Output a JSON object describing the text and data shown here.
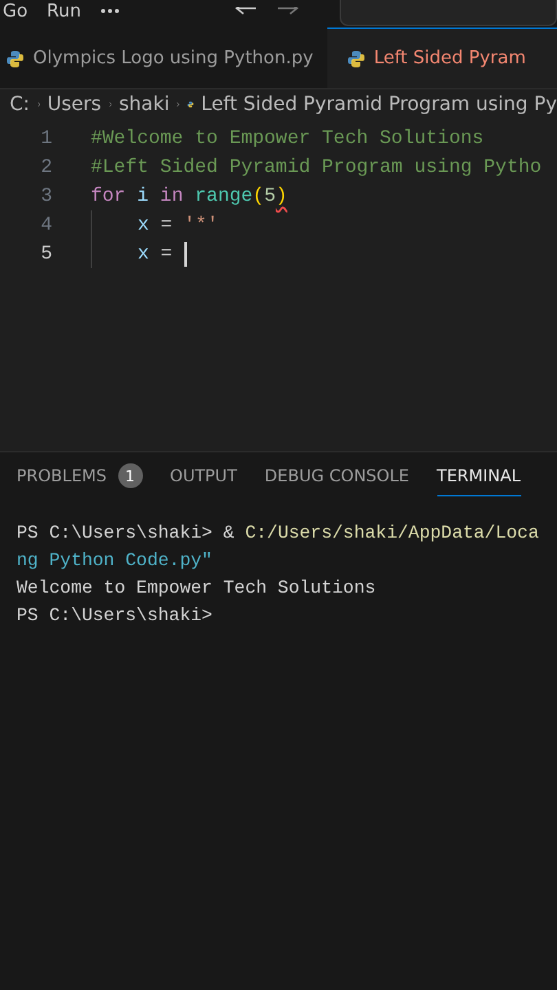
{
  "menu": [
    "Go",
    "Run"
  ],
  "tabs": [
    {
      "label": "Olympics Logo using Python.py",
      "selected": false,
      "error": false
    },
    {
      "label": "Left Sided Pyram",
      "selected": true,
      "error": true
    }
  ],
  "breadcrumb": [
    "C:",
    "Users",
    "shaki",
    "Left Sided Pyramid Program using Py"
  ],
  "code": [
    {
      "number": "1",
      "current": false,
      "tokens": [
        {
          "kind": "comment",
          "text": "#Welcome to Empower Tech Solutions"
        }
      ]
    },
    {
      "number": "2",
      "current": false,
      "tokens": [
        {
          "kind": "comment",
          "text": "#Left Sided Pyramid Program using Pytho"
        }
      ]
    },
    {
      "number": "3",
      "current": false,
      "tokens": [
        {
          "kind": "keyword",
          "text": "for"
        },
        {
          "kind": "variable",
          "text": " i"
        },
        {
          "kind": "keyword",
          "text": " in"
        },
        {
          "kind": "function",
          "text": " range"
        },
        {
          "kind": "bracket",
          "text": "("
        },
        {
          "kind": "number",
          "text": "5"
        },
        {
          "kind": "bracket",
          "text": ")",
          "error": true
        }
      ]
    },
    {
      "number": "4",
      "current": false,
      "indent": true,
      "tokens": [
        {
          "kind": "variable",
          "text": "x"
        },
        {
          "kind": "plain",
          "text": " = "
        },
        {
          "kind": "string",
          "text": "'*'"
        }
      ]
    },
    {
      "number": "5",
      "current": true,
      "cursor": true,
      "indent": true,
      "tokens": [
        {
          "kind": "variable",
          "text": "x"
        },
        {
          "kind": "plain",
          "text": " = "
        }
      ]
    }
  ],
  "panel": {
    "tabs": [
      {
        "label": "PROBLEMS",
        "badge": "1",
        "selected": false
      },
      {
        "label": "OUTPUT",
        "selected": false
      },
      {
        "label": "DEBUG CONSOLE",
        "selected": false
      },
      {
        "label": "TERMINAL",
        "selected": true
      }
    ],
    "terminal": [
      [
        {
          "kind": "plain",
          "text": "PS C:\\Users\\shaki> & "
        },
        {
          "kind": "path",
          "text": "C:/Users/shaki/AppData/Loca"
        }
      ],
      [
        {
          "kind": "string",
          "text": "ng Python Code.py\""
        }
      ],
      [
        {
          "kind": "plain",
          "text": "Welcome to Empower Tech Solutions"
        }
      ],
      [
        {
          "kind": "plain",
          "text": "PS C:\\Users\\shaki>"
        }
      ]
    ]
  }
}
